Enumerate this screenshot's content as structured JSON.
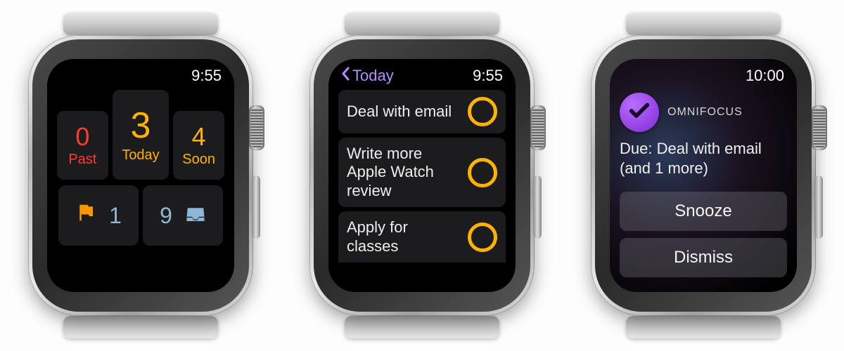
{
  "screen1": {
    "time": "9:55",
    "tiles": {
      "past": {
        "count": "0",
        "label": "Past"
      },
      "today": {
        "count": "3",
        "label": "Today"
      },
      "soon": {
        "count": "4",
        "label": "Soon"
      }
    },
    "flagged_count": "1",
    "inbox_count": "9",
    "icons": {
      "flag": "flag-icon",
      "inbox": "inbox-icon"
    }
  },
  "screen2": {
    "time": "9:55",
    "back_label": "Today",
    "tasks": [
      {
        "title": "Deal with email"
      },
      {
        "title": "Write more Apple Watch review"
      },
      {
        "title": "Apply for classes"
      }
    ]
  },
  "screen3": {
    "time": "10:00",
    "app_name": "OMNIFOCUS",
    "notification_text": "Due: Deal with email (and 1 more)",
    "actions": {
      "snooze": "Snooze",
      "dismiss": "Dismiss"
    },
    "icon": "checkmark-icon"
  },
  "colors": {
    "accent_purple": "#a65dff",
    "accent_amber": "#ffb300",
    "accent_red": "#ff3b30",
    "accent_blue": "#8eb6d6"
  }
}
